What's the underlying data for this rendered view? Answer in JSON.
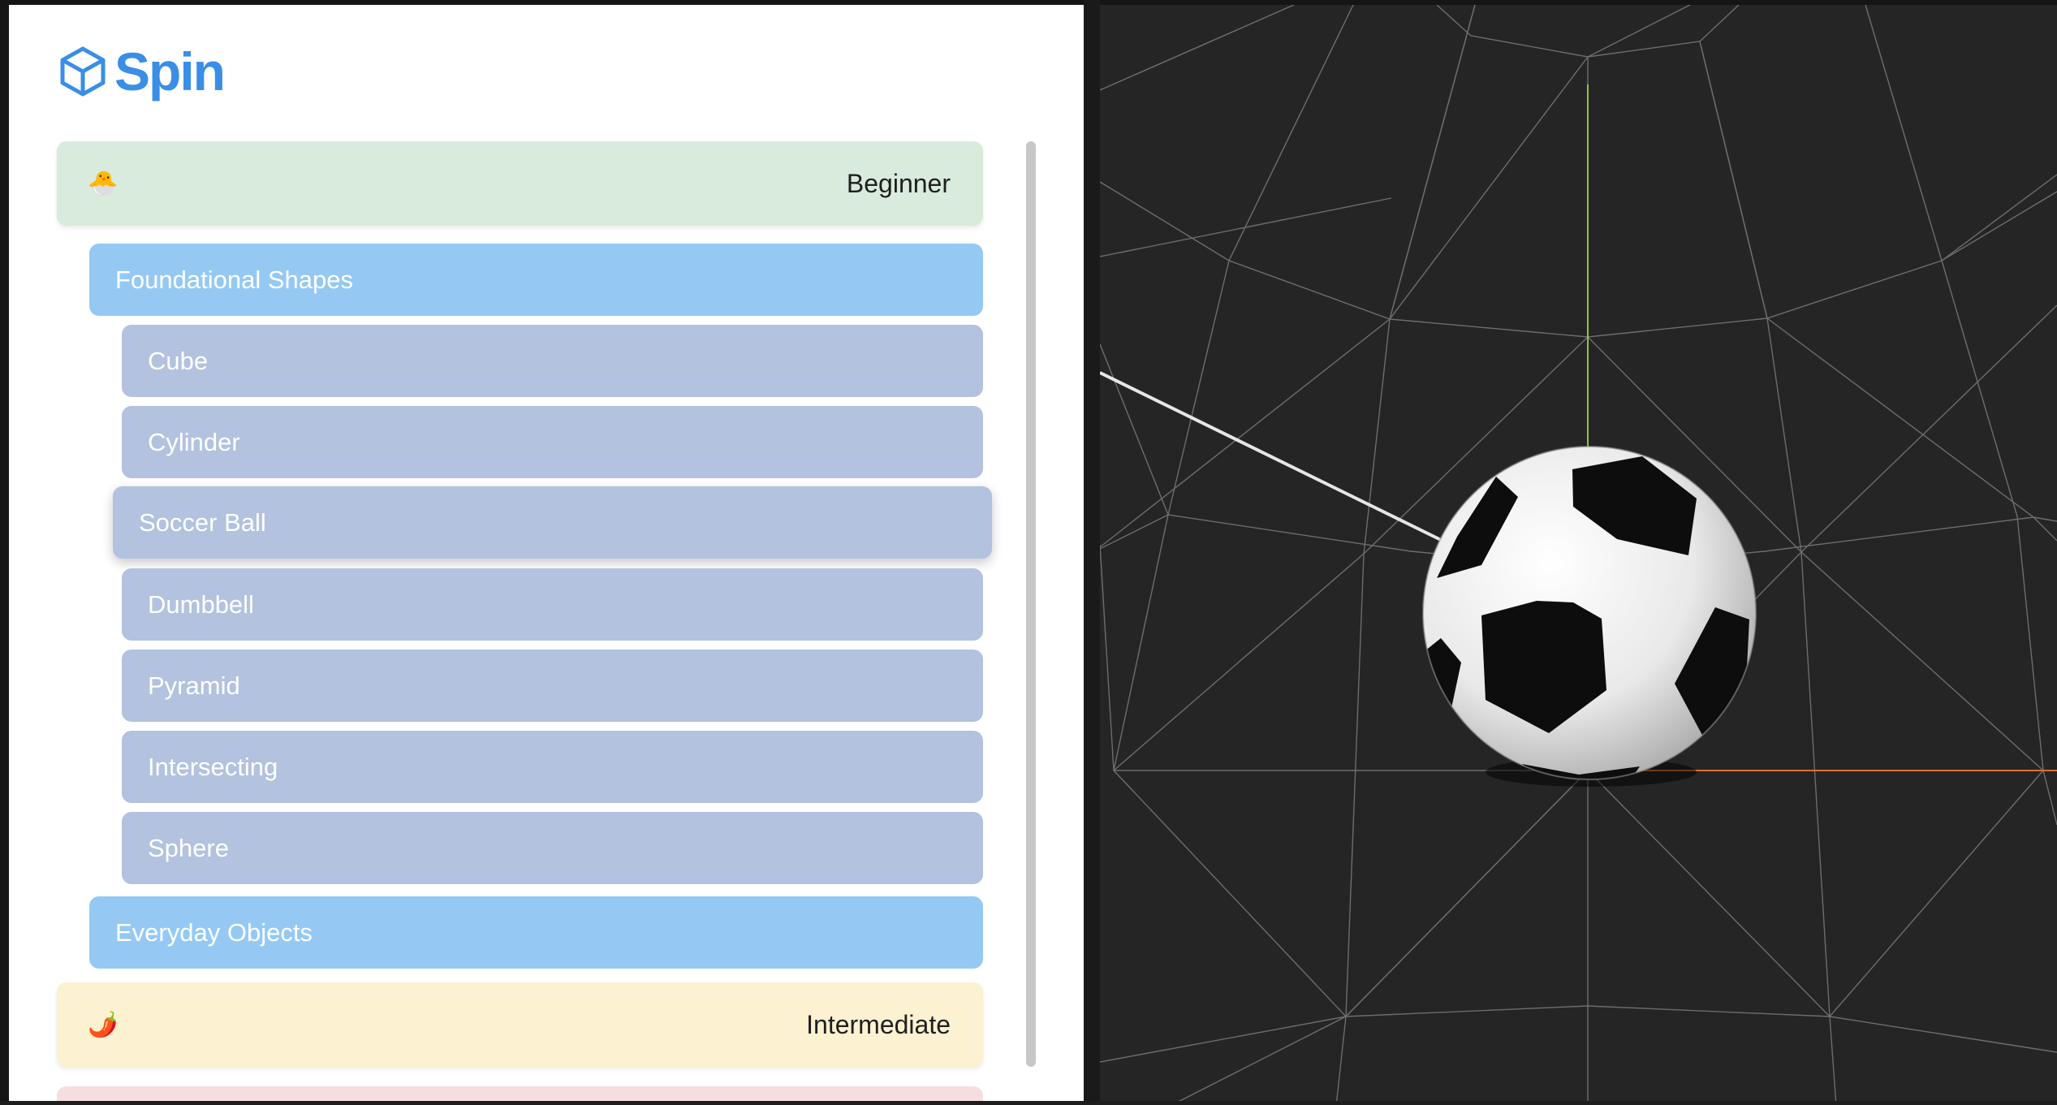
{
  "app": {
    "name": "Spin"
  },
  "levels": [
    {
      "emoji": "🐣",
      "label": "Beginner"
    },
    {
      "emoji": "🌶️",
      "label": "Intermediate"
    }
  ],
  "categories": [
    {
      "label": "Foundational Shapes",
      "expanded": true
    },
    {
      "label": "Everyday Objects",
      "expanded": false
    }
  ],
  "items": [
    {
      "label": "Cube"
    },
    {
      "label": "Cylinder"
    },
    {
      "label": "Soccer Ball",
      "selected": true
    },
    {
      "label": "Dumbbell"
    },
    {
      "label": "Pyramid"
    },
    {
      "label": "Intersecting"
    },
    {
      "label": "Sphere"
    }
  ],
  "colors": {
    "brand": "#3a8ee6",
    "beginner_bg": "#d9ebdc",
    "intermediate_bg": "#fcf1d0",
    "advanced_bg": "#f6dede",
    "category_bg": "#95c9f4",
    "item_bg": "#b2c2df",
    "viewport_bg": "#252525",
    "grid_line": "#7a7a7a",
    "y_axis": "#8dc63f",
    "x_axis": "#d9742b"
  },
  "viewport": {
    "object": "soccer-ball",
    "grid": true
  }
}
